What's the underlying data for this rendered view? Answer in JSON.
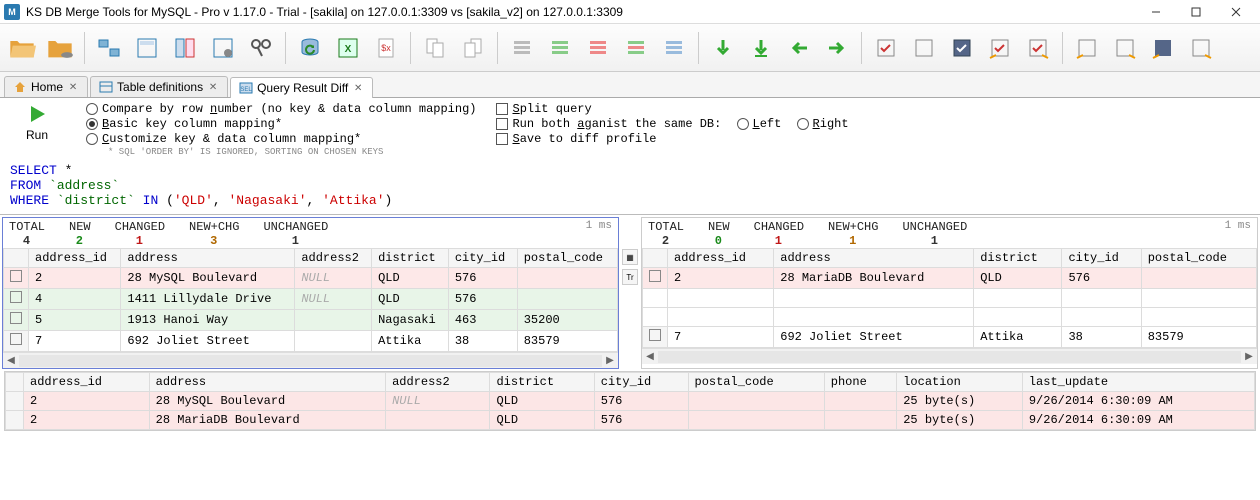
{
  "title_bar": {
    "app_badge": "M",
    "title": "KS DB Merge Tools for MySQL - Pro v 1.17.0 - Trial - [sakila] on 127.0.0.1:3309 vs [sakila_v2] on 127.0.0.1:3309"
  },
  "tabs": {
    "home": "Home",
    "tabledef": "Table definitions",
    "qrdiff": "Query Result Diff"
  },
  "options": {
    "run_label": "Run",
    "radio1": "Compare by row number (no key & data column mapping)",
    "radio2": "Basic key column mapping*",
    "radio3": "Customize key & data column mapping*",
    "note": "* SQL 'ORDER BY' IS IGNORED, SORTING ON CHOSEN KEYS",
    "chk1": "Split query",
    "chk2_prefix": "Run both aganist the same DB:",
    "chk2_left": "Left",
    "chk2_right": "Right",
    "chk3": "Save to diff profile"
  },
  "sql": {
    "line1_kw1": "SELECT",
    "line1_rest": " *",
    "line2_kw": "FROM",
    "line2_ident": " `address`",
    "line3_kw": "WHERE",
    "line3_ident": " `district`",
    "line3_kw2": " IN ",
    "line3_p1": "(",
    "line3_s1": "'QLD'",
    "line3_c1": ", ",
    "line3_s2": "'Nagasaki'",
    "line3_c2": ", ",
    "line3_s3": "'Attika'",
    "line3_p2": ")"
  },
  "left_stats": {
    "total_l": "TOTAL",
    "total_v": "4",
    "new_l": "NEW",
    "new_v": "2",
    "changed_l": "CHANGED",
    "changed_v": "1",
    "newchg_l": "NEW+CHG",
    "newchg_v": "3",
    "unchanged_l": "UNCHANGED",
    "unchanged_v": "1",
    "timing": "1 ms"
  },
  "right_stats": {
    "total_l": "TOTAL",
    "total_v": "2",
    "new_l": "NEW",
    "new_v": "0",
    "changed_l": "CHANGED",
    "changed_v": "1",
    "newchg_l": "NEW+CHG",
    "newchg_v": "1",
    "unchanged_l": "UNCHANGED",
    "unchanged_v": "1",
    "timing": "1 ms"
  },
  "grid_headers": {
    "address_id": "address_id",
    "address": "address",
    "address2": "address2",
    "district": "district",
    "city_id": "city_id",
    "postal_code": "postal_code",
    "phone": "phone",
    "location": "location",
    "last_update": "last_update"
  },
  "left_rows": [
    {
      "id": "2",
      "address": "28 MySQL Boulevard",
      "address2": "NULL",
      "district": "QLD",
      "city_id": "576",
      "postal": "",
      "cls": "changed",
      "addr_cell_changed": true
    },
    {
      "id": "4",
      "address": "1411 Lillydale Drive",
      "address2": "NULL",
      "district": "QLD",
      "city_id": "576",
      "postal": "",
      "cls": "new"
    },
    {
      "id": "5",
      "address": "1913 Hanoi Way",
      "address2": "",
      "district": "Nagasaki",
      "city_id": "463",
      "postal": "35200",
      "cls": "new"
    },
    {
      "id": "7",
      "address": "692 Joliet Street",
      "address2": "",
      "district": "Attika",
      "city_id": "38",
      "postal": "83579",
      "cls": ""
    }
  ],
  "right_rows": [
    {
      "id": "2",
      "address": "28 MariaDB Boulevard",
      "address2": "",
      "district": "QLD",
      "city_id": "576",
      "postal": "",
      "cls": "changed",
      "addr_cell_changed": true
    },
    {
      "id": "",
      "address": "",
      "address2": "",
      "district": "",
      "city_id": "",
      "postal": "",
      "cls": "blank"
    },
    {
      "id": "",
      "address": "",
      "address2": "",
      "district": "",
      "city_id": "",
      "postal": "",
      "cls": "blank"
    },
    {
      "id": "7",
      "address": "692 Joliet Street",
      "address2": "",
      "district": "Attika",
      "city_id": "38",
      "postal": "83579",
      "cls": ""
    }
  ],
  "merge_rows": [
    {
      "id": "2",
      "address": "28 MySQL Boulevard",
      "address2": "NULL",
      "district": "QLD",
      "city_id": "576",
      "postal": "",
      "phone": "",
      "location": "25 byte(s)",
      "last_update": "9/26/2014 6:30:09 AM"
    },
    {
      "id": "2",
      "address": "28 MariaDB Boulevard",
      "address2": "",
      "district": "QLD",
      "city_id": "576",
      "postal": "",
      "phone": "",
      "location": "25 byte(s)",
      "last_update": "9/26/2014 6:30:09 AM"
    }
  ],
  "null_text": "NULL"
}
